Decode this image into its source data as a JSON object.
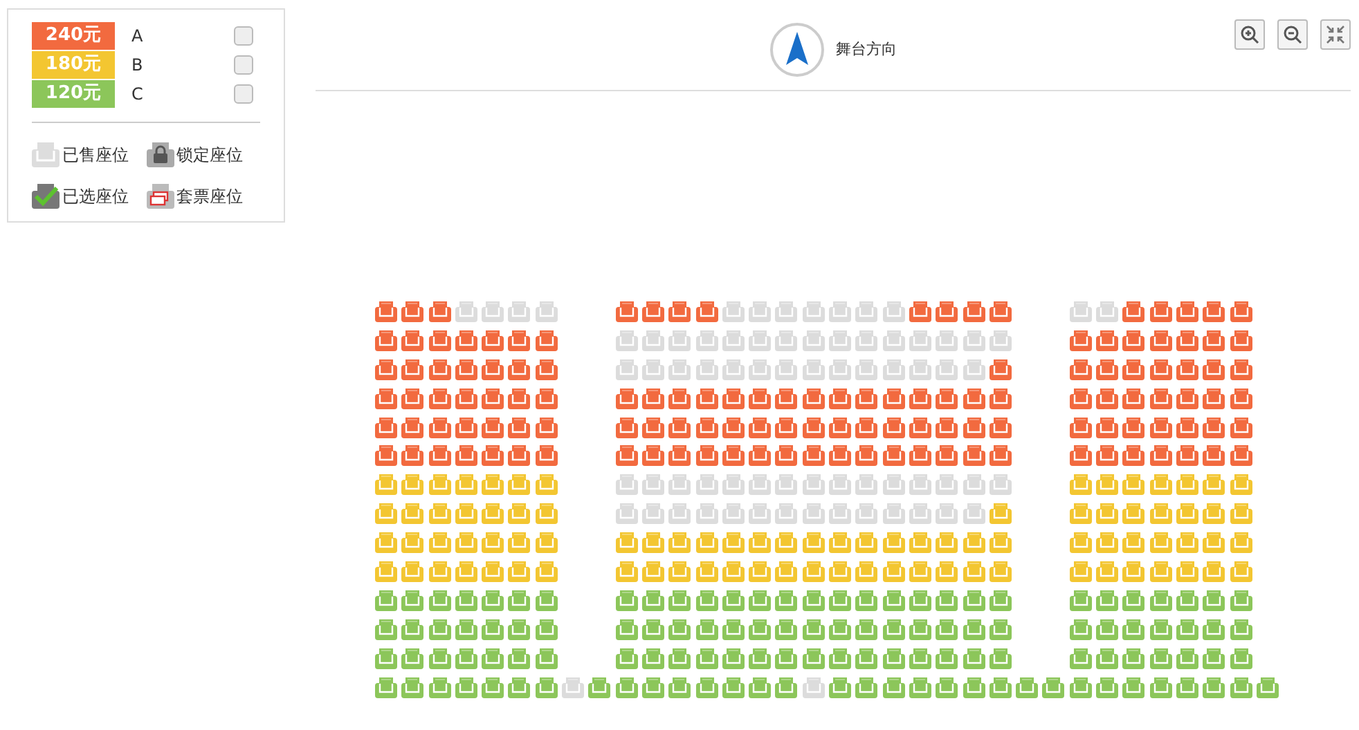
{
  "legend": {
    "tiers": [
      {
        "price": "240元",
        "name": "A",
        "color": "#f26a3f",
        "checked": false
      },
      {
        "price": "180元",
        "name": "B",
        "color": "#f3c631",
        "checked": false
      },
      {
        "price": "120元",
        "name": "C",
        "color": "#8cc65a",
        "checked": false
      }
    ],
    "statuses": [
      {
        "kind": "sold",
        "label": "已售座位"
      },
      {
        "kind": "locked",
        "label": "锁定座位"
      },
      {
        "kind": "selected",
        "label": "已选座位"
      },
      {
        "kind": "package",
        "label": "套票座位"
      }
    ]
  },
  "stage": {
    "label": "舞台方向"
  },
  "toolbar": [
    {
      "kind": "zoom-in"
    },
    {
      "kind": "zoom-out"
    },
    {
      "kind": "fit"
    }
  ],
  "seat_rows": [
    {
      "blocks": [
        {
          "seats": [
            {
              "kind": "open",
              "color": "#f26a3f"
            },
            {
              "kind": "open",
              "color": "#f26a3f"
            },
            {
              "kind": "open",
              "color": "#f26a3f"
            },
            {
              "kind": "sold"
            },
            {
              "kind": "sold"
            },
            {
              "kind": "sold"
            },
            {
              "kind": "sold"
            }
          ]
        },
        {
          "seats": [
            {
              "kind": "open",
              "color": "#f26a3f"
            },
            {
              "kind": "open",
              "color": "#f26a3f"
            },
            {
              "kind": "open",
              "color": "#f26a3f"
            },
            {
              "kind": "open",
              "color": "#f26a3f"
            },
            {
              "kind": "sold"
            },
            {
              "kind": "sold"
            },
            {
              "kind": "sold"
            },
            {
              "kind": "sold"
            },
            {
              "kind": "sold"
            },
            {
              "kind": "sold"
            },
            {
              "kind": "sold"
            },
            {
              "kind": "open",
              "color": "#f26a3f"
            },
            {
              "kind": "open",
              "color": "#f26a3f"
            },
            {
              "kind": "open",
              "color": "#f26a3f"
            },
            {
              "kind": "open",
              "color": "#f26a3f"
            }
          ]
        },
        {
          "seats": [
            {
              "kind": "sold"
            },
            {
              "kind": "sold"
            },
            {
              "kind": "open",
              "color": "#f26a3f"
            },
            {
              "kind": "open",
              "color": "#f26a3f"
            },
            {
              "kind": "open",
              "color": "#f26a3f"
            },
            {
              "kind": "open",
              "color": "#f26a3f"
            },
            {
              "kind": "open",
              "color": "#f26a3f"
            }
          ]
        }
      ]
    },
    {
      "blocks": [
        {
          "seats": [
            {
              "kind": "open",
              "color": "#f26a3f"
            },
            {
              "kind": "open",
              "color": "#f26a3f"
            },
            {
              "kind": "open",
              "color": "#f26a3f"
            },
            {
              "kind": "open",
              "color": "#f26a3f"
            },
            {
              "kind": "open",
              "color": "#f26a3f"
            },
            {
              "kind": "open",
              "color": "#f26a3f"
            },
            {
              "kind": "open",
              "color": "#f26a3f"
            }
          ]
        },
        {
          "seats": [
            {
              "kind": "sold"
            },
            {
              "kind": "sold"
            },
            {
              "kind": "sold"
            },
            {
              "kind": "sold"
            },
            {
              "kind": "sold"
            },
            {
              "kind": "sold"
            },
            {
              "kind": "sold"
            },
            {
              "kind": "sold"
            },
            {
              "kind": "sold"
            },
            {
              "kind": "sold"
            },
            {
              "kind": "sold"
            },
            {
              "kind": "sold"
            },
            {
              "kind": "sold"
            },
            {
              "kind": "sold"
            },
            {
              "kind": "sold"
            }
          ]
        },
        {
          "seats": [
            {
              "kind": "open",
              "color": "#f26a3f"
            },
            {
              "kind": "open",
              "color": "#f26a3f"
            },
            {
              "kind": "open",
              "color": "#f26a3f"
            },
            {
              "kind": "open",
              "color": "#f26a3f"
            },
            {
              "kind": "open",
              "color": "#f26a3f"
            },
            {
              "kind": "open",
              "color": "#f26a3f"
            },
            {
              "kind": "open",
              "color": "#f26a3f"
            }
          ]
        }
      ]
    },
    {
      "blocks": [
        {
          "seats": [
            {
              "kind": "open",
              "color": "#f26a3f"
            },
            {
              "kind": "open",
              "color": "#f26a3f"
            },
            {
              "kind": "open",
              "color": "#f26a3f"
            },
            {
              "kind": "open",
              "color": "#f26a3f"
            },
            {
              "kind": "open",
              "color": "#f26a3f"
            },
            {
              "kind": "open",
              "color": "#f26a3f"
            },
            {
              "kind": "open",
              "color": "#f26a3f"
            }
          ]
        },
        {
          "seats": [
            {
              "kind": "sold"
            },
            {
              "kind": "sold"
            },
            {
              "kind": "sold"
            },
            {
              "kind": "sold"
            },
            {
              "kind": "sold"
            },
            {
              "kind": "sold"
            },
            {
              "kind": "sold"
            },
            {
              "kind": "sold"
            },
            {
              "kind": "sold"
            },
            {
              "kind": "sold"
            },
            {
              "kind": "sold"
            },
            {
              "kind": "sold"
            },
            {
              "kind": "sold"
            },
            {
              "kind": "sold"
            },
            {
              "kind": "open",
              "color": "#f26a3f"
            }
          ]
        },
        {
          "seats": [
            {
              "kind": "open",
              "color": "#f26a3f"
            },
            {
              "kind": "open",
              "color": "#f26a3f"
            },
            {
              "kind": "open",
              "color": "#f26a3f"
            },
            {
              "kind": "open",
              "color": "#f26a3f"
            },
            {
              "kind": "open",
              "color": "#f26a3f"
            },
            {
              "kind": "open",
              "color": "#f26a3f"
            },
            {
              "kind": "open",
              "color": "#f26a3f"
            }
          ]
        }
      ]
    },
    {
      "blocks": [
        {
          "seats": [
            {
              "kind": "open",
              "color": "#f26a3f"
            },
            {
              "kind": "open",
              "color": "#f26a3f"
            },
            {
              "kind": "open",
              "color": "#f26a3f"
            },
            {
              "kind": "open",
              "color": "#f26a3f"
            },
            {
              "kind": "open",
              "color": "#f26a3f"
            },
            {
              "kind": "open",
              "color": "#f26a3f"
            },
            {
              "kind": "open",
              "color": "#f26a3f"
            }
          ]
        },
        {
          "seats": [
            {
              "kind": "open",
              "color": "#f26a3f"
            },
            {
              "kind": "open",
              "color": "#f26a3f"
            },
            {
              "kind": "open",
              "color": "#f26a3f"
            },
            {
              "kind": "open",
              "color": "#f26a3f"
            },
            {
              "kind": "open",
              "color": "#f26a3f"
            },
            {
              "kind": "open",
              "color": "#f26a3f"
            },
            {
              "kind": "open",
              "color": "#f26a3f"
            },
            {
              "kind": "open",
              "color": "#f26a3f"
            },
            {
              "kind": "open",
              "color": "#f26a3f"
            },
            {
              "kind": "open",
              "color": "#f26a3f"
            },
            {
              "kind": "open",
              "color": "#f26a3f"
            },
            {
              "kind": "open",
              "color": "#f26a3f"
            },
            {
              "kind": "open",
              "color": "#f26a3f"
            },
            {
              "kind": "open",
              "color": "#f26a3f"
            },
            {
              "kind": "open",
              "color": "#f26a3f"
            }
          ]
        },
        {
          "seats": [
            {
              "kind": "open",
              "color": "#f26a3f"
            },
            {
              "kind": "open",
              "color": "#f26a3f"
            },
            {
              "kind": "open",
              "color": "#f26a3f"
            },
            {
              "kind": "open",
              "color": "#f26a3f"
            },
            {
              "kind": "open",
              "color": "#f26a3f"
            },
            {
              "kind": "open",
              "color": "#f26a3f"
            },
            {
              "kind": "open",
              "color": "#f26a3f"
            }
          ]
        }
      ]
    },
    {
      "blocks": [
        {
          "seats": [
            {
              "kind": "open",
              "color": "#f26a3f"
            },
            {
              "kind": "open",
              "color": "#f26a3f"
            },
            {
              "kind": "open",
              "color": "#f26a3f"
            },
            {
              "kind": "open",
              "color": "#f26a3f"
            },
            {
              "kind": "open",
              "color": "#f26a3f"
            },
            {
              "kind": "open",
              "color": "#f26a3f"
            },
            {
              "kind": "open",
              "color": "#f26a3f"
            }
          ]
        },
        {
          "seats": [
            {
              "kind": "open",
              "color": "#f26a3f"
            },
            {
              "kind": "open",
              "color": "#f26a3f"
            },
            {
              "kind": "open",
              "color": "#f26a3f"
            },
            {
              "kind": "open",
              "color": "#f26a3f"
            },
            {
              "kind": "open",
              "color": "#f26a3f"
            },
            {
              "kind": "open",
              "color": "#f26a3f"
            },
            {
              "kind": "open",
              "color": "#f26a3f"
            },
            {
              "kind": "open",
              "color": "#f26a3f"
            },
            {
              "kind": "open",
              "color": "#f26a3f"
            },
            {
              "kind": "open",
              "color": "#f26a3f"
            },
            {
              "kind": "open",
              "color": "#f26a3f"
            },
            {
              "kind": "open",
              "color": "#f26a3f"
            },
            {
              "kind": "open",
              "color": "#f26a3f"
            },
            {
              "kind": "open",
              "color": "#f26a3f"
            },
            {
              "kind": "open",
              "color": "#f26a3f"
            }
          ]
        },
        {
          "seats": [
            {
              "kind": "open",
              "color": "#f26a3f"
            },
            {
              "kind": "open",
              "color": "#f26a3f"
            },
            {
              "kind": "open",
              "color": "#f26a3f"
            },
            {
              "kind": "open",
              "color": "#f26a3f"
            },
            {
              "kind": "open",
              "color": "#f26a3f"
            },
            {
              "kind": "open",
              "color": "#f26a3f"
            },
            {
              "kind": "open",
              "color": "#f26a3f"
            }
          ]
        }
      ]
    },
    {
      "blocks": [
        {
          "seats": [
            {
              "kind": "open",
              "color": "#f26a3f"
            },
            {
              "kind": "open",
              "color": "#f26a3f"
            },
            {
              "kind": "open",
              "color": "#f26a3f"
            },
            {
              "kind": "open",
              "color": "#f26a3f"
            },
            {
              "kind": "open",
              "color": "#f26a3f"
            },
            {
              "kind": "open",
              "color": "#f26a3f"
            },
            {
              "kind": "open",
              "color": "#f26a3f"
            }
          ]
        },
        {
          "seats": [
            {
              "kind": "open",
              "color": "#f26a3f"
            },
            {
              "kind": "open",
              "color": "#f26a3f"
            },
            {
              "kind": "open",
              "color": "#f26a3f"
            },
            {
              "kind": "open",
              "color": "#f26a3f"
            },
            {
              "kind": "open",
              "color": "#f26a3f"
            },
            {
              "kind": "open",
              "color": "#f26a3f"
            },
            {
              "kind": "open",
              "color": "#f26a3f"
            },
            {
              "kind": "open",
              "color": "#f26a3f"
            },
            {
              "kind": "open",
              "color": "#f26a3f"
            },
            {
              "kind": "open",
              "color": "#f26a3f"
            },
            {
              "kind": "open",
              "color": "#f26a3f"
            },
            {
              "kind": "open",
              "color": "#f26a3f"
            },
            {
              "kind": "open",
              "color": "#f26a3f"
            },
            {
              "kind": "open",
              "color": "#f26a3f"
            },
            {
              "kind": "open",
              "color": "#f26a3f"
            }
          ]
        },
        {
          "seats": [
            {
              "kind": "open",
              "color": "#f26a3f"
            },
            {
              "kind": "open",
              "color": "#f26a3f"
            },
            {
              "kind": "open",
              "color": "#f26a3f"
            },
            {
              "kind": "open",
              "color": "#f26a3f"
            },
            {
              "kind": "open",
              "color": "#f26a3f"
            },
            {
              "kind": "open",
              "color": "#f26a3f"
            },
            {
              "kind": "open",
              "color": "#f26a3f"
            }
          ]
        }
      ]
    },
    {
      "blocks": [
        {
          "seats": [
            {
              "kind": "open",
              "color": "#f3c631"
            },
            {
              "kind": "open",
              "color": "#f3c631"
            },
            {
              "kind": "open",
              "color": "#f3c631"
            },
            {
              "kind": "open",
              "color": "#f3c631"
            },
            {
              "kind": "open",
              "color": "#f3c631"
            },
            {
              "kind": "open",
              "color": "#f3c631"
            },
            {
              "kind": "open",
              "color": "#f3c631"
            }
          ]
        },
        {
          "seats": [
            {
              "kind": "sold"
            },
            {
              "kind": "sold"
            },
            {
              "kind": "sold"
            },
            {
              "kind": "sold"
            },
            {
              "kind": "sold"
            },
            {
              "kind": "sold"
            },
            {
              "kind": "sold"
            },
            {
              "kind": "sold"
            },
            {
              "kind": "sold"
            },
            {
              "kind": "sold"
            },
            {
              "kind": "sold"
            },
            {
              "kind": "sold"
            },
            {
              "kind": "sold"
            },
            {
              "kind": "sold"
            },
            {
              "kind": "sold"
            }
          ]
        },
        {
          "seats": [
            {
              "kind": "open",
              "color": "#f3c631"
            },
            {
              "kind": "open",
              "color": "#f3c631"
            },
            {
              "kind": "open",
              "color": "#f3c631"
            },
            {
              "kind": "open",
              "color": "#f3c631"
            },
            {
              "kind": "open",
              "color": "#f3c631"
            },
            {
              "kind": "open",
              "color": "#f3c631"
            },
            {
              "kind": "open",
              "color": "#f3c631"
            }
          ]
        }
      ]
    },
    {
      "blocks": [
        {
          "seats": [
            {
              "kind": "open",
              "color": "#f3c631"
            },
            {
              "kind": "open",
              "color": "#f3c631"
            },
            {
              "kind": "open",
              "color": "#f3c631"
            },
            {
              "kind": "open",
              "color": "#f3c631"
            },
            {
              "kind": "open",
              "color": "#f3c631"
            },
            {
              "kind": "open",
              "color": "#f3c631"
            },
            {
              "kind": "open",
              "color": "#f3c631"
            }
          ]
        },
        {
          "seats": [
            {
              "kind": "sold"
            },
            {
              "kind": "sold"
            },
            {
              "kind": "sold"
            },
            {
              "kind": "sold"
            },
            {
              "kind": "sold"
            },
            {
              "kind": "sold"
            },
            {
              "kind": "sold"
            },
            {
              "kind": "sold"
            },
            {
              "kind": "sold"
            },
            {
              "kind": "sold"
            },
            {
              "kind": "sold"
            },
            {
              "kind": "sold"
            },
            {
              "kind": "sold"
            },
            {
              "kind": "sold"
            },
            {
              "kind": "open",
              "color": "#f3c631"
            }
          ]
        },
        {
          "seats": [
            {
              "kind": "open",
              "color": "#f3c631"
            },
            {
              "kind": "open",
              "color": "#f3c631"
            },
            {
              "kind": "open",
              "color": "#f3c631"
            },
            {
              "kind": "open",
              "color": "#f3c631"
            },
            {
              "kind": "open",
              "color": "#f3c631"
            },
            {
              "kind": "open",
              "color": "#f3c631"
            },
            {
              "kind": "open",
              "color": "#f3c631"
            }
          ]
        }
      ]
    },
    {
      "blocks": [
        {
          "seats": [
            {
              "kind": "open",
              "color": "#f3c631"
            },
            {
              "kind": "open",
              "color": "#f3c631"
            },
            {
              "kind": "open",
              "color": "#f3c631"
            },
            {
              "kind": "open",
              "color": "#f3c631"
            },
            {
              "kind": "open",
              "color": "#f3c631"
            },
            {
              "kind": "open",
              "color": "#f3c631"
            },
            {
              "kind": "open",
              "color": "#f3c631"
            }
          ]
        },
        {
          "seats": [
            {
              "kind": "open",
              "color": "#f3c631"
            },
            {
              "kind": "open",
              "color": "#f3c631"
            },
            {
              "kind": "open",
              "color": "#f3c631"
            },
            {
              "kind": "open",
              "color": "#f3c631"
            },
            {
              "kind": "open",
              "color": "#f3c631"
            },
            {
              "kind": "open",
              "color": "#f3c631"
            },
            {
              "kind": "open",
              "color": "#f3c631"
            },
            {
              "kind": "open",
              "color": "#f3c631"
            },
            {
              "kind": "open",
              "color": "#f3c631"
            },
            {
              "kind": "open",
              "color": "#f3c631"
            },
            {
              "kind": "open",
              "color": "#f3c631"
            },
            {
              "kind": "open",
              "color": "#f3c631"
            },
            {
              "kind": "open",
              "color": "#f3c631"
            },
            {
              "kind": "open",
              "color": "#f3c631"
            },
            {
              "kind": "open",
              "color": "#f3c631"
            }
          ]
        },
        {
          "seats": [
            {
              "kind": "open",
              "color": "#f3c631"
            },
            {
              "kind": "open",
              "color": "#f3c631"
            },
            {
              "kind": "open",
              "color": "#f3c631"
            },
            {
              "kind": "open",
              "color": "#f3c631"
            },
            {
              "kind": "open",
              "color": "#f3c631"
            },
            {
              "kind": "open",
              "color": "#f3c631"
            },
            {
              "kind": "open",
              "color": "#f3c631"
            }
          ]
        }
      ]
    },
    {
      "blocks": [
        {
          "seats": [
            {
              "kind": "open",
              "color": "#f3c631"
            },
            {
              "kind": "open",
              "color": "#f3c631"
            },
            {
              "kind": "open",
              "color": "#f3c631"
            },
            {
              "kind": "open",
              "color": "#f3c631"
            },
            {
              "kind": "open",
              "color": "#f3c631"
            },
            {
              "kind": "open",
              "color": "#f3c631"
            },
            {
              "kind": "open",
              "color": "#f3c631"
            }
          ]
        },
        {
          "seats": [
            {
              "kind": "open",
              "color": "#f3c631"
            },
            {
              "kind": "open",
              "color": "#f3c631"
            },
            {
              "kind": "open",
              "color": "#f3c631"
            },
            {
              "kind": "open",
              "color": "#f3c631"
            },
            {
              "kind": "open",
              "color": "#f3c631"
            },
            {
              "kind": "open",
              "color": "#f3c631"
            },
            {
              "kind": "open",
              "color": "#f3c631"
            },
            {
              "kind": "open",
              "color": "#f3c631"
            },
            {
              "kind": "open",
              "color": "#f3c631"
            },
            {
              "kind": "open",
              "color": "#f3c631"
            },
            {
              "kind": "open",
              "color": "#f3c631"
            },
            {
              "kind": "open",
              "color": "#f3c631"
            },
            {
              "kind": "open",
              "color": "#f3c631"
            },
            {
              "kind": "open",
              "color": "#f3c631"
            },
            {
              "kind": "open",
              "color": "#f3c631"
            }
          ]
        },
        {
          "seats": [
            {
              "kind": "open",
              "color": "#f3c631"
            },
            {
              "kind": "open",
              "color": "#f3c631"
            },
            {
              "kind": "open",
              "color": "#f3c631"
            },
            {
              "kind": "open",
              "color": "#f3c631"
            },
            {
              "kind": "open",
              "color": "#f3c631"
            },
            {
              "kind": "open",
              "color": "#f3c631"
            },
            {
              "kind": "open",
              "color": "#f3c631"
            }
          ]
        }
      ]
    },
    {
      "blocks": [
        {
          "seats": [
            {
              "kind": "open",
              "color": "#8cc65a"
            },
            {
              "kind": "open",
              "color": "#8cc65a"
            },
            {
              "kind": "open",
              "color": "#8cc65a"
            },
            {
              "kind": "open",
              "color": "#8cc65a"
            },
            {
              "kind": "open",
              "color": "#8cc65a"
            },
            {
              "kind": "open",
              "color": "#8cc65a"
            },
            {
              "kind": "open",
              "color": "#8cc65a"
            }
          ]
        },
        {
          "seats": [
            {
              "kind": "open",
              "color": "#8cc65a"
            },
            {
              "kind": "open",
              "color": "#8cc65a"
            },
            {
              "kind": "open",
              "color": "#8cc65a"
            },
            {
              "kind": "open",
              "color": "#8cc65a"
            },
            {
              "kind": "open",
              "color": "#8cc65a"
            },
            {
              "kind": "open",
              "color": "#8cc65a"
            },
            {
              "kind": "open",
              "color": "#8cc65a"
            },
            {
              "kind": "open",
              "color": "#8cc65a"
            },
            {
              "kind": "open",
              "color": "#8cc65a"
            },
            {
              "kind": "open",
              "color": "#8cc65a"
            },
            {
              "kind": "open",
              "color": "#8cc65a"
            },
            {
              "kind": "open",
              "color": "#8cc65a"
            },
            {
              "kind": "open",
              "color": "#8cc65a"
            },
            {
              "kind": "open",
              "color": "#8cc65a"
            },
            {
              "kind": "open",
              "color": "#8cc65a"
            }
          ]
        },
        {
          "seats": [
            {
              "kind": "open",
              "color": "#8cc65a"
            },
            {
              "kind": "open",
              "color": "#8cc65a"
            },
            {
              "kind": "open",
              "color": "#8cc65a"
            },
            {
              "kind": "open",
              "color": "#8cc65a"
            },
            {
              "kind": "open",
              "color": "#8cc65a"
            },
            {
              "kind": "open",
              "color": "#8cc65a"
            },
            {
              "kind": "open",
              "color": "#8cc65a"
            }
          ]
        }
      ]
    },
    {
      "blocks": [
        {
          "seats": [
            {
              "kind": "open",
              "color": "#8cc65a"
            },
            {
              "kind": "open",
              "color": "#8cc65a"
            },
            {
              "kind": "open",
              "color": "#8cc65a"
            },
            {
              "kind": "open",
              "color": "#8cc65a"
            },
            {
              "kind": "open",
              "color": "#8cc65a"
            },
            {
              "kind": "open",
              "color": "#8cc65a"
            },
            {
              "kind": "open",
              "color": "#8cc65a"
            }
          ]
        },
        {
          "seats": [
            {
              "kind": "open",
              "color": "#8cc65a"
            },
            {
              "kind": "open",
              "color": "#8cc65a"
            },
            {
              "kind": "open",
              "color": "#8cc65a"
            },
            {
              "kind": "open",
              "color": "#8cc65a"
            },
            {
              "kind": "open",
              "color": "#8cc65a"
            },
            {
              "kind": "open",
              "color": "#8cc65a"
            },
            {
              "kind": "open",
              "color": "#8cc65a"
            },
            {
              "kind": "open",
              "color": "#8cc65a"
            },
            {
              "kind": "open",
              "color": "#8cc65a"
            },
            {
              "kind": "open",
              "color": "#8cc65a"
            },
            {
              "kind": "open",
              "color": "#8cc65a"
            },
            {
              "kind": "open",
              "color": "#8cc65a"
            },
            {
              "kind": "open",
              "color": "#8cc65a"
            },
            {
              "kind": "open",
              "color": "#8cc65a"
            },
            {
              "kind": "open",
              "color": "#8cc65a"
            }
          ]
        },
        {
          "seats": [
            {
              "kind": "open",
              "color": "#8cc65a"
            },
            {
              "kind": "open",
              "color": "#8cc65a"
            },
            {
              "kind": "open",
              "color": "#8cc65a"
            },
            {
              "kind": "open",
              "color": "#8cc65a"
            },
            {
              "kind": "open",
              "color": "#8cc65a"
            },
            {
              "kind": "open",
              "color": "#8cc65a"
            },
            {
              "kind": "open",
              "color": "#8cc65a"
            }
          ]
        }
      ]
    },
    {
      "blocks": [
        {
          "seats": [
            {
              "kind": "open",
              "color": "#8cc65a"
            },
            {
              "kind": "open",
              "color": "#8cc65a"
            },
            {
              "kind": "open",
              "color": "#8cc65a"
            },
            {
              "kind": "open",
              "color": "#8cc65a"
            },
            {
              "kind": "open",
              "color": "#8cc65a"
            },
            {
              "kind": "open",
              "color": "#8cc65a"
            },
            {
              "kind": "open",
              "color": "#8cc65a"
            }
          ]
        },
        {
          "seats": [
            {
              "kind": "open",
              "color": "#8cc65a"
            },
            {
              "kind": "open",
              "color": "#8cc65a"
            },
            {
              "kind": "open",
              "color": "#8cc65a"
            },
            {
              "kind": "open",
              "color": "#8cc65a"
            },
            {
              "kind": "open",
              "color": "#8cc65a"
            },
            {
              "kind": "open",
              "color": "#8cc65a"
            },
            {
              "kind": "open",
              "color": "#8cc65a"
            },
            {
              "kind": "open",
              "color": "#8cc65a"
            },
            {
              "kind": "open",
              "color": "#8cc65a"
            },
            {
              "kind": "open",
              "color": "#8cc65a"
            },
            {
              "kind": "open",
              "color": "#8cc65a"
            },
            {
              "kind": "open",
              "color": "#8cc65a"
            },
            {
              "kind": "open",
              "color": "#8cc65a"
            },
            {
              "kind": "open",
              "color": "#8cc65a"
            },
            {
              "kind": "open",
              "color": "#8cc65a"
            }
          ]
        },
        {
          "seats": [
            {
              "kind": "open",
              "color": "#8cc65a"
            },
            {
              "kind": "open",
              "color": "#8cc65a"
            },
            {
              "kind": "open",
              "color": "#8cc65a"
            },
            {
              "kind": "open",
              "color": "#8cc65a"
            },
            {
              "kind": "open",
              "color": "#8cc65a"
            },
            {
              "kind": "open",
              "color": "#8cc65a"
            },
            {
              "kind": "open",
              "color": "#8cc65a"
            }
          ]
        }
      ]
    },
    {
      "blocks": [
        {
          "seats": [
            {
              "kind": "open",
              "color": "#8cc65a"
            },
            {
              "kind": "open",
              "color": "#8cc65a"
            },
            {
              "kind": "open",
              "color": "#8cc65a"
            },
            {
              "kind": "open",
              "color": "#8cc65a"
            },
            {
              "kind": "open",
              "color": "#8cc65a"
            },
            {
              "kind": "open",
              "color": "#8cc65a"
            },
            {
              "kind": "open",
              "color": "#8cc65a"
            },
            {
              "kind": "sold"
            },
            {
              "kind": "open",
              "color": "#8cc65a"
            },
            {
              "kind": "open",
              "color": "#8cc65a"
            },
            {
              "kind": "open",
              "color": "#8cc65a"
            },
            {
              "kind": "open",
              "color": "#8cc65a"
            },
            {
              "kind": "open",
              "color": "#8cc65a"
            },
            {
              "kind": "open",
              "color": "#8cc65a"
            },
            {
              "kind": "open",
              "color": "#8cc65a"
            },
            {
              "kind": "open",
              "color": "#8cc65a"
            },
            {
              "kind": "sold"
            },
            {
              "kind": "open",
              "color": "#8cc65a"
            },
            {
              "kind": "open",
              "color": "#8cc65a"
            },
            {
              "kind": "open",
              "color": "#8cc65a"
            },
            {
              "kind": "open",
              "color": "#8cc65a"
            },
            {
              "kind": "open",
              "color": "#8cc65a"
            },
            {
              "kind": "open",
              "color": "#8cc65a"
            },
            {
              "kind": "open",
              "color": "#8cc65a"
            },
            {
              "kind": "open",
              "color": "#8cc65a"
            },
            {
              "kind": "open",
              "color": "#8cc65a"
            },
            {
              "kind": "open",
              "color": "#8cc65a"
            },
            {
              "kind": "open",
              "color": "#8cc65a"
            },
            {
              "kind": "open",
              "color": "#8cc65a"
            },
            {
              "kind": "open",
              "color": "#8cc65a"
            },
            {
              "kind": "open",
              "color": "#8cc65a"
            },
            {
              "kind": "open",
              "color": "#8cc65a"
            },
            {
              "kind": "open",
              "color": "#8cc65a"
            },
            {
              "kind": "open",
              "color": "#8cc65a"
            }
          ]
        }
      ]
    }
  ]
}
